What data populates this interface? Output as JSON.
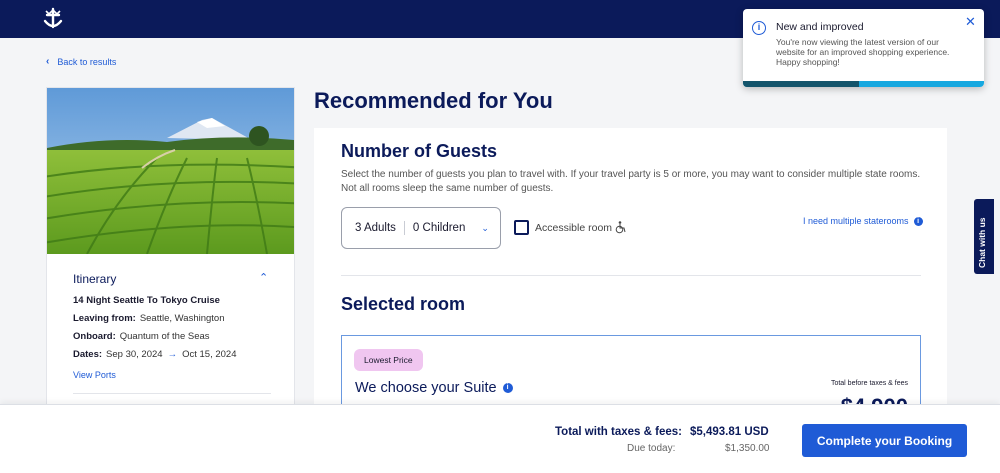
{
  "header": {
    "logo_icon": "anchor-crown-logo-icon"
  },
  "back_link": {
    "label": "Back to results"
  },
  "itinerary": {
    "heading": "Itinerary",
    "title": "14 Night Seattle To Tokyo Cruise",
    "leaving_label": "Leaving from:",
    "leaving_value": "Seattle, Washington",
    "onboard_label": "Onboard:",
    "onboard_value": "Quantum of the Seas",
    "dates_label": "Dates:",
    "date_start": "Sep 30, 2024",
    "date_end": "Oct 15, 2024",
    "view_ports": "View Ports"
  },
  "main": {
    "title": "Recommended for You",
    "guests": {
      "title": "Number of Guests",
      "description": "Select the number of guests you plan to travel with. If your travel party is 5 or more, you may want to consider multiple state rooms. Not all rooms sleep the same number of guests.",
      "adults": "3 Adults",
      "children": "0 Children",
      "accessible_label": "Accessible room",
      "multiple_link": "I need multiple staterooms"
    },
    "selected_room": {
      "title": "Selected room",
      "badge": "Lowest Price",
      "room_title": "We choose your Suite",
      "total_before_label": "Total before taxes & fees",
      "price": "$4,900"
    }
  },
  "footer": {
    "total_label": "Total with taxes & fees:",
    "total_value": "$5,493.81 USD",
    "due_label": "Due today:",
    "due_value": "$1,350.00",
    "cta": "Complete your Booking"
  },
  "toast": {
    "title": "New and improved",
    "body": "You're now viewing the latest version of our website for an improved shopping experience. Happy shopping!",
    "progress": 0.48
  },
  "chat": {
    "label": "Chat with us"
  },
  "colors": {
    "navy": "#0b1a5a",
    "blue": "#1f5bd6",
    "badge_pink": "#f0c6f0"
  }
}
